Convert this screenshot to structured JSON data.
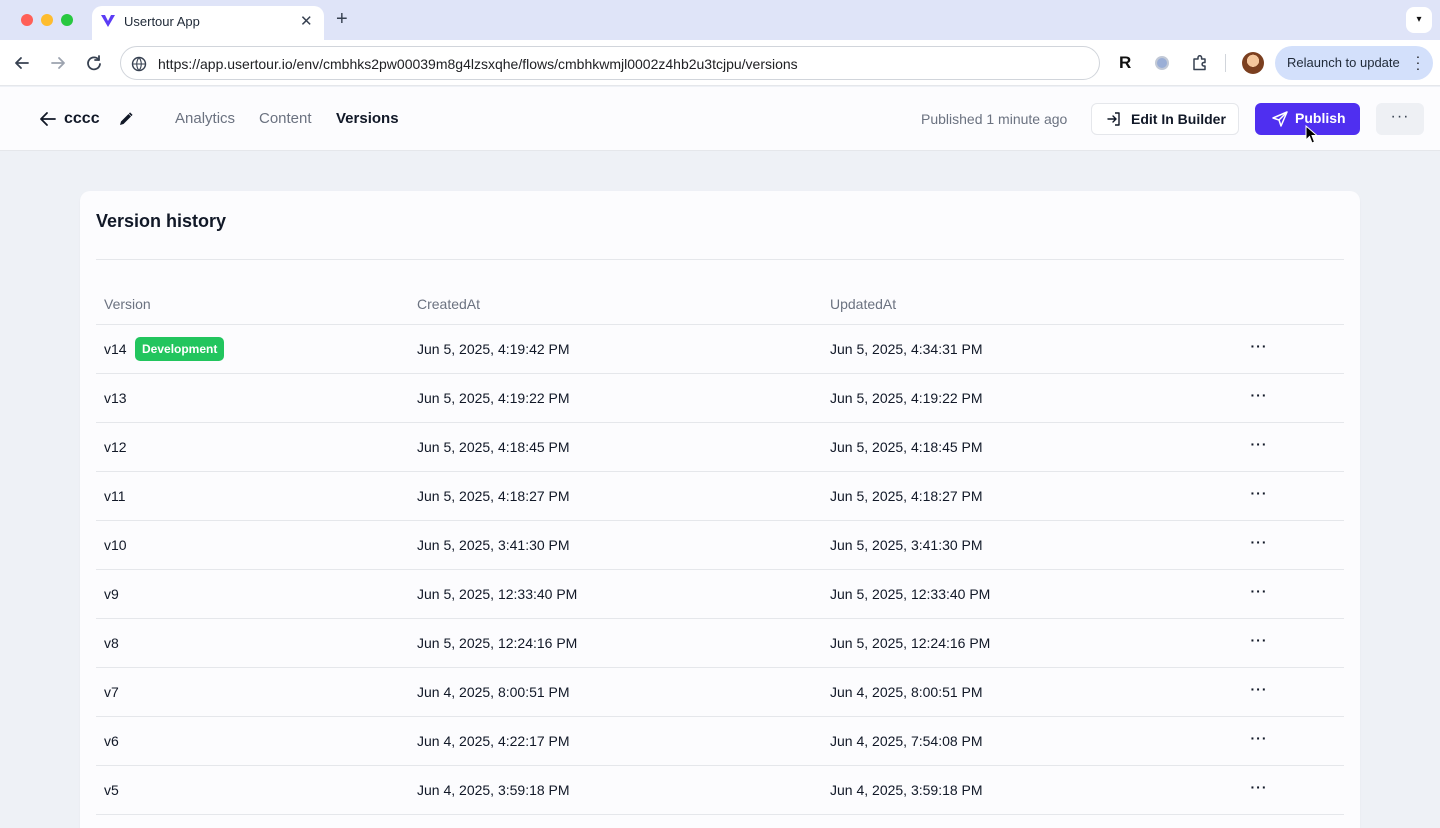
{
  "browser": {
    "tab_title": "Usertour App",
    "url": "https://app.usertour.io/env/cmbhks2pw00039m8g4lzsxqhe/flows/cmbhkwmjl0002z4hb2u3tcjpu/versions",
    "relaunch_label": "Relaunch to update",
    "extension_label": "R"
  },
  "header": {
    "flow_name": "cccc",
    "nav": [
      "Analytics",
      "Content",
      "Versions"
    ],
    "active_nav": "Versions",
    "published_status": "Published 1 minute ago",
    "edit_builder_label": "Edit In Builder",
    "publish_label": "Publish",
    "more_label": "···"
  },
  "card": {
    "title": "Version history",
    "columns": [
      "Version",
      "CreatedAt",
      "UpdatedAt"
    ],
    "rows": [
      {
        "version": "v14",
        "badge": "Development",
        "created": "Jun 5, 2025, 4:19:42 PM",
        "updated": "Jun 5, 2025, 4:34:31 PM"
      },
      {
        "version": "v13",
        "created": "Jun 5, 2025, 4:19:22 PM",
        "updated": "Jun 5, 2025, 4:19:22 PM"
      },
      {
        "version": "v12",
        "created": "Jun 5, 2025, 4:18:45 PM",
        "updated": "Jun 5, 2025, 4:18:45 PM"
      },
      {
        "version": "v11",
        "created": "Jun 5, 2025, 4:18:27 PM",
        "updated": "Jun 5, 2025, 4:18:27 PM"
      },
      {
        "version": "v10",
        "created": "Jun 5, 2025, 3:41:30 PM",
        "updated": "Jun 5, 2025, 3:41:30 PM"
      },
      {
        "version": "v9",
        "created": "Jun 5, 2025, 12:33:40 PM",
        "updated": "Jun 5, 2025, 12:33:40 PM"
      },
      {
        "version": "v8",
        "created": "Jun 5, 2025, 12:24:16 PM",
        "updated": "Jun 5, 2025, 12:24:16 PM"
      },
      {
        "version": "v7",
        "created": "Jun 4, 2025, 8:00:51 PM",
        "updated": "Jun 4, 2025, 8:00:51 PM"
      },
      {
        "version": "v6",
        "created": "Jun 4, 2025, 4:22:17 PM",
        "updated": "Jun 4, 2025, 7:54:08 PM"
      },
      {
        "version": "v5",
        "created": "Jun 4, 2025, 3:59:18 PM",
        "updated": "Jun 4, 2025, 3:59:18 PM"
      }
    ],
    "row_more_label": "···"
  },
  "colors": {
    "accent": "#4f2ff0",
    "badge_green": "#22c55e",
    "page_bg": "#eef1f6"
  }
}
